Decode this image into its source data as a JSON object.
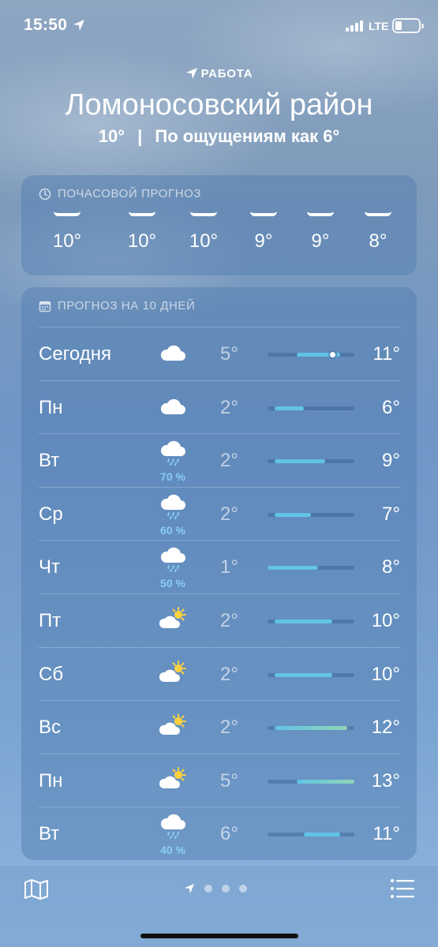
{
  "status": {
    "time": "15:50",
    "network": "LTE"
  },
  "header": {
    "location_label": "РАБОТА",
    "city": "Ломоносовский район",
    "current_temp": "10°",
    "separator": "|",
    "feels_like": "По ощущениям как 6°"
  },
  "hourly": {
    "title": "ПОЧАСОВОЙ ПРОГНОЗ",
    "items": [
      {
        "temp": "10°"
      },
      {
        "temp": "10°"
      },
      {
        "temp": "10°"
      },
      {
        "temp": "9°"
      },
      {
        "temp": "9°"
      },
      {
        "temp": "8°"
      }
    ]
  },
  "daily": {
    "title": "ПРОГНОЗ НА 10 ДНЕЙ",
    "range_min": 1,
    "range_max": 13,
    "days": [
      {
        "day": "Сегодня",
        "icon": "cloud-icon",
        "precip": "",
        "low": "5°",
        "high": "11°",
        "low_val": 5,
        "high_val": 11,
        "current_val": 10
      },
      {
        "day": "Пн",
        "icon": "cloud-icon",
        "precip": "",
        "low": "2°",
        "high": "6°",
        "low_val": 2,
        "high_val": 6
      },
      {
        "day": "Вт",
        "icon": "cloud-rain-icon",
        "precip": "70 %",
        "low": "2°",
        "high": "9°",
        "low_val": 2,
        "high_val": 9
      },
      {
        "day": "Ср",
        "icon": "cloud-rain-icon",
        "precip": "60 %",
        "low": "2°",
        "high": "7°",
        "low_val": 2,
        "high_val": 7
      },
      {
        "day": "Чт",
        "icon": "cloud-rain-icon",
        "precip": "50 %",
        "low": "1°",
        "high": "8°",
        "low_val": 1,
        "high_val": 8
      },
      {
        "day": "Пт",
        "icon": "partly-cloudy-icon",
        "precip": "",
        "low": "2°",
        "high": "10°",
        "low_val": 2,
        "high_val": 10
      },
      {
        "day": "Сб",
        "icon": "partly-cloudy-icon",
        "precip": "",
        "low": "2°",
        "high": "10°",
        "low_val": 2,
        "high_val": 10
      },
      {
        "day": "Вс",
        "icon": "partly-cloudy-icon",
        "precip": "",
        "low": "2°",
        "high": "12°",
        "low_val": 2,
        "high_val": 12
      },
      {
        "day": "Пн",
        "icon": "partly-cloudy-icon",
        "precip": "",
        "low": "5°",
        "high": "13°",
        "low_val": 5,
        "high_val": 13
      },
      {
        "day": "Вт",
        "icon": "cloud-rain-icon",
        "precip": "40 %",
        "low": "6°",
        "high": "11°",
        "low_val": 6,
        "high_val": 11
      }
    ]
  },
  "colors": {
    "bar_cool": "#62c3e6",
    "bar_warm": "#8fd7b6",
    "precip_text": "#89cdf3"
  },
  "bottom_bar": {
    "map_icon": "map-icon",
    "list_icon": "list-icon",
    "page_count": 3
  }
}
